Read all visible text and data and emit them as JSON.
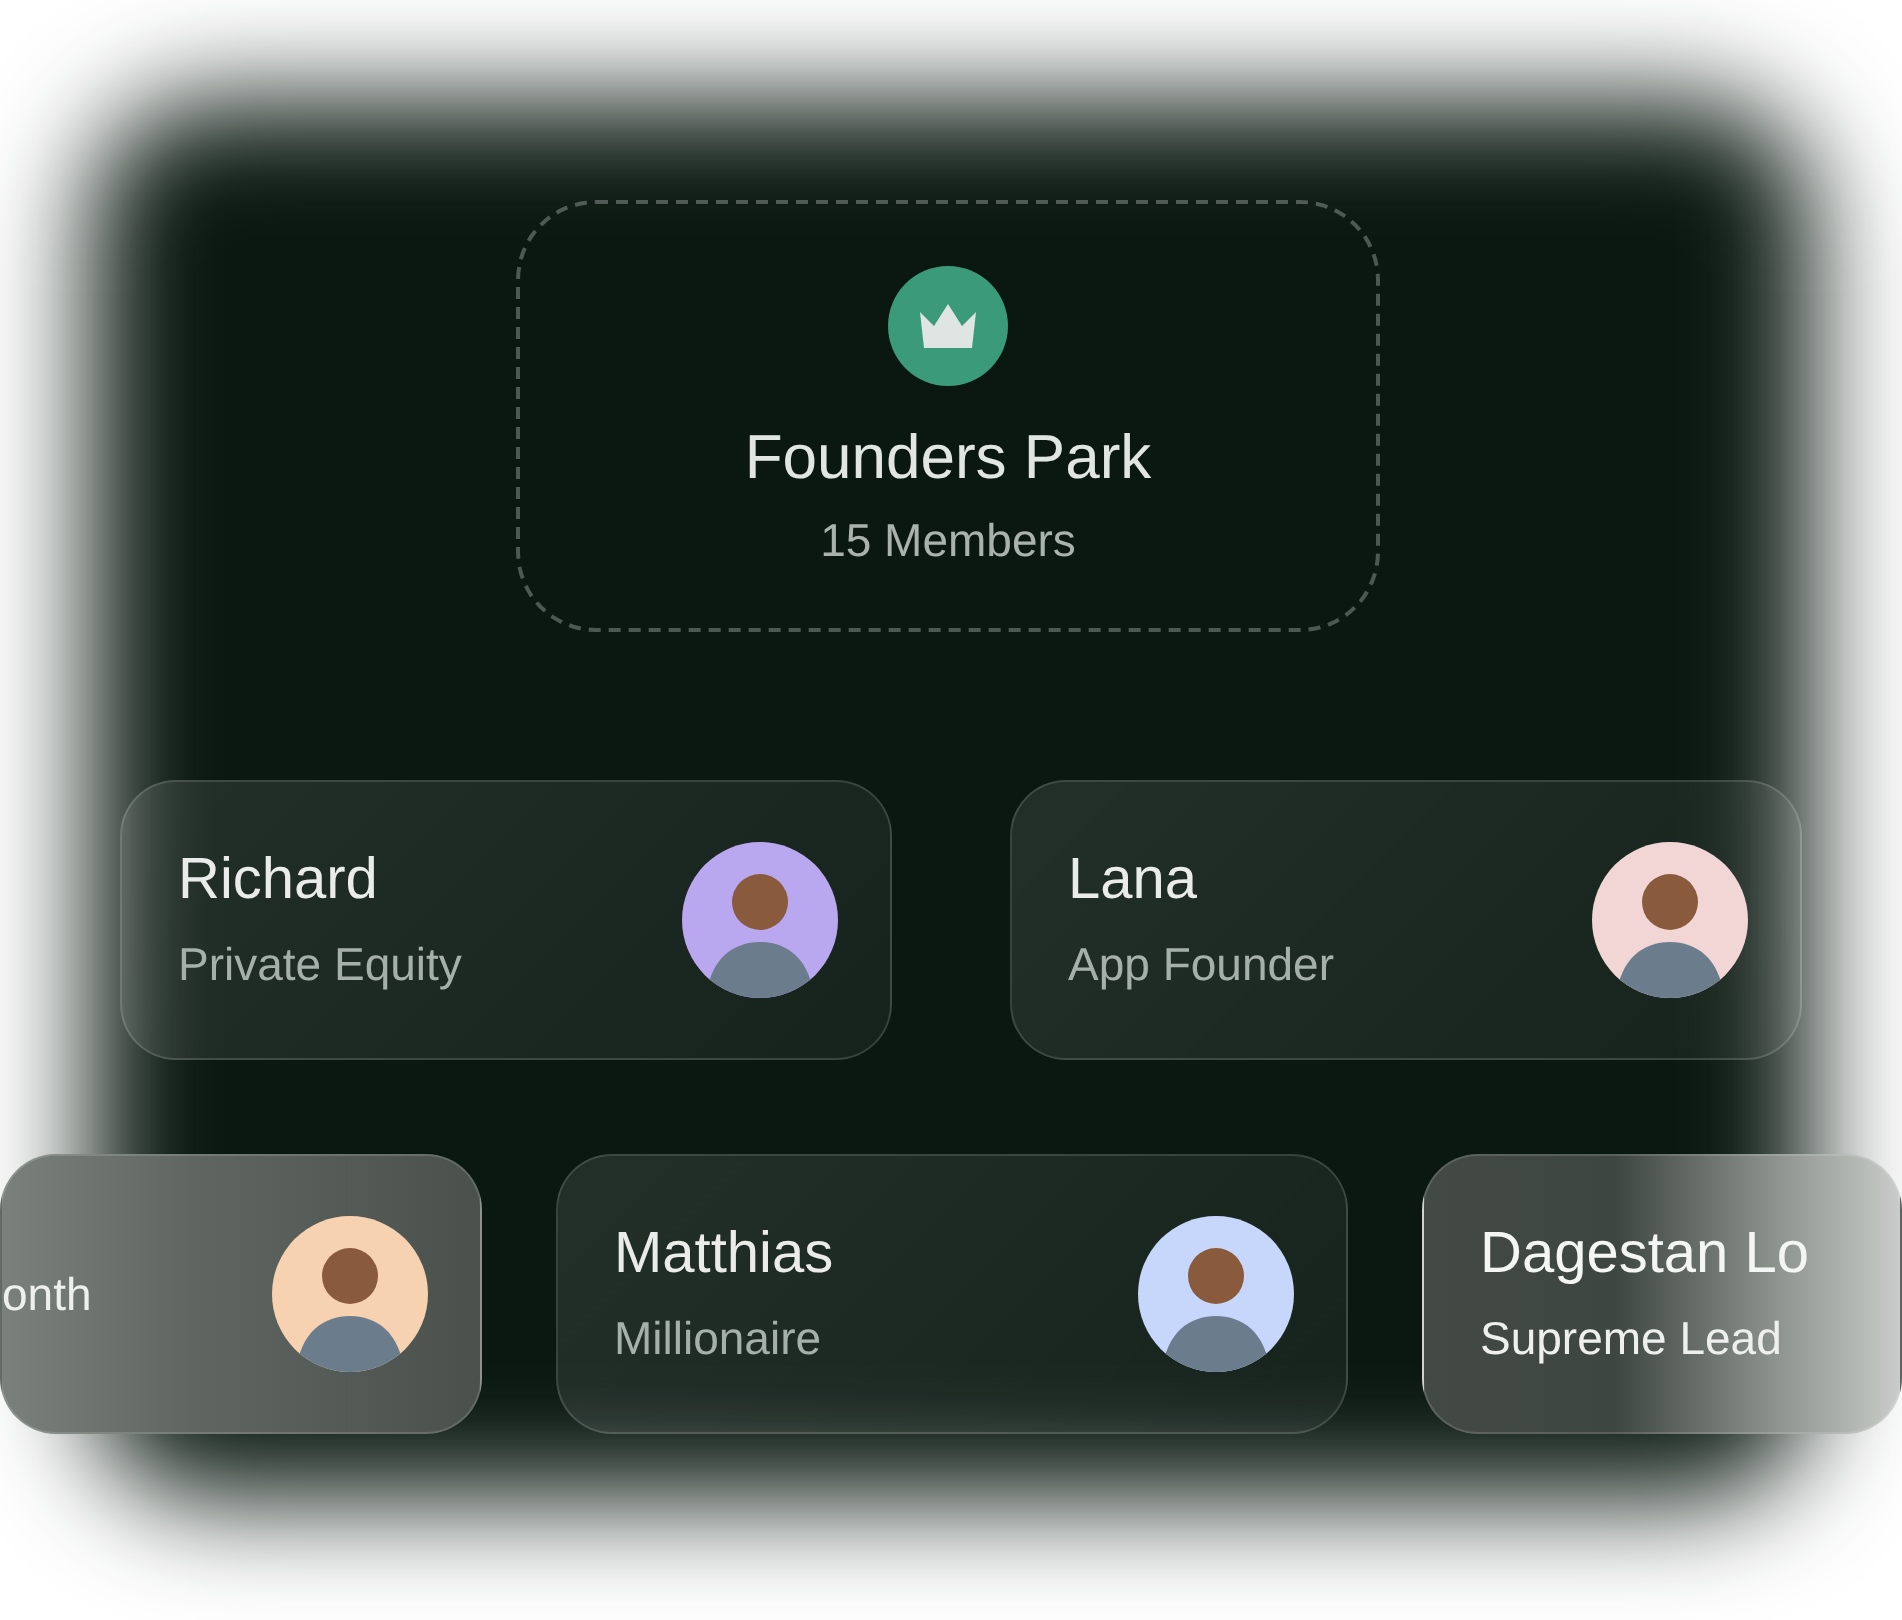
{
  "group": {
    "title": "Founders Park",
    "subtitle": "15 Members"
  },
  "rows": [
    [
      {
        "name": "Richard",
        "role": "Private Equity",
        "color": "#b9a8f0"
      },
      {
        "name": "Lana",
        "role": "App Founder",
        "color": "#f2d6d6"
      }
    ],
    [
      {
        "role": "onth",
        "color": "#f6d2b0"
      },
      {
        "name": "Matthias",
        "role": "Millionaire",
        "color": "#c7d6fb"
      },
      {
        "name": "Dagestan Lo",
        "role": "Supreme Lead"
      }
    ]
  ]
}
